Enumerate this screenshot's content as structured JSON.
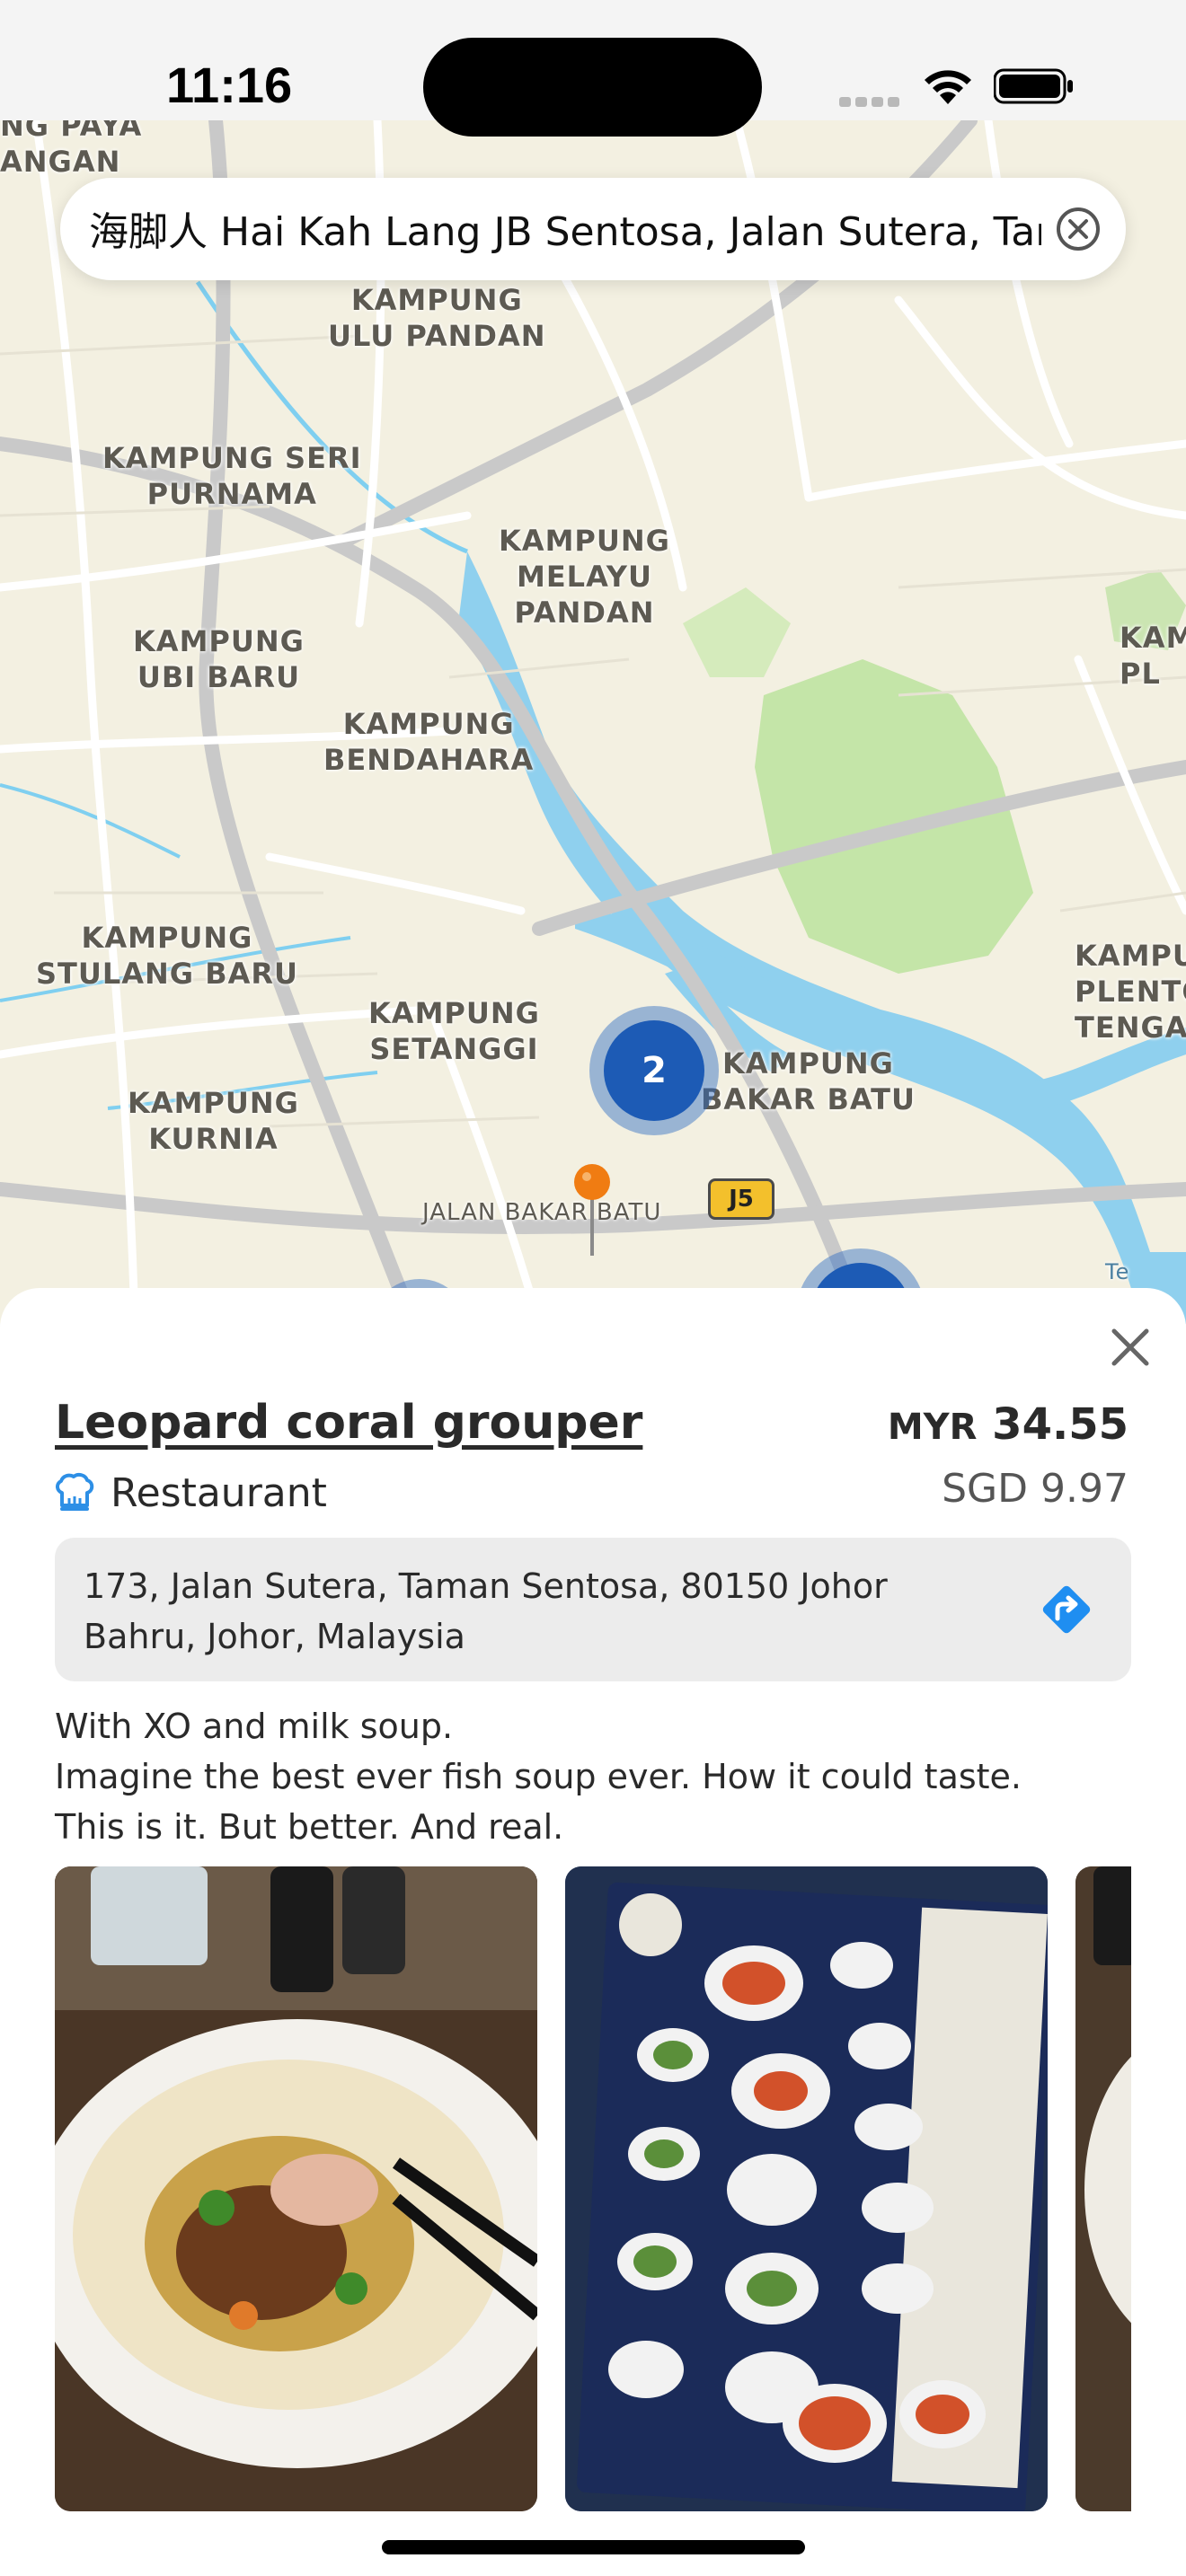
{
  "status_bar": {
    "time": "11:16"
  },
  "search": {
    "value": "海脚人 Hai Kah Lang JB Sentosa, Jalan Sutera, Taman Sentosa"
  },
  "map": {
    "labels": {
      "paya": "NG PAYA\nANGAN",
      "ulu_pandan": "KAMPUNG\nULU PANDAN",
      "seri_purnama": "KAMPUNG SERI\nPURNAMA",
      "melayu_pandan": "KAMPUNG\nMELAYU\nPANDAN",
      "ubi_baru": "KAMPUNG\nUBI BARU",
      "bendahara": "KAMPUNG\nBENDAHARA",
      "kam_pl": "KAM\nPL",
      "stulang_baru": "KAMPUNG\nSTULANG BARU",
      "plentong": "KAMPU\nPLENTO\nTENGA",
      "setanggi": "KAMPUNG\nSETANGGI",
      "bakar_batu": "KAMPUNG\nBAKAR BATU",
      "kurnia": "KAMPUNG\nKURNIA",
      "road": "JALAN BAKAR BATU",
      "road_shield": "J5",
      "te": "Te"
    },
    "cluster_count": "2",
    "accent": "#1d5bb5",
    "pin_color": "#f07c12"
  },
  "place": {
    "title": "Leopard coral grouper",
    "category": "Restaurant",
    "category_icon": "chef-hat-icon",
    "price_currency": "MYR",
    "price_amount": "34.55",
    "price_alt": "SGD 9.97",
    "address": "173, Jalan Sutera, Taman Sentosa, 80150 Johor Bahru, Johor, Malaysia",
    "description": "With XO and milk soup.\nImagine the best ever fish soup ever. How it could taste.\nThis is it. But better. And real."
  }
}
